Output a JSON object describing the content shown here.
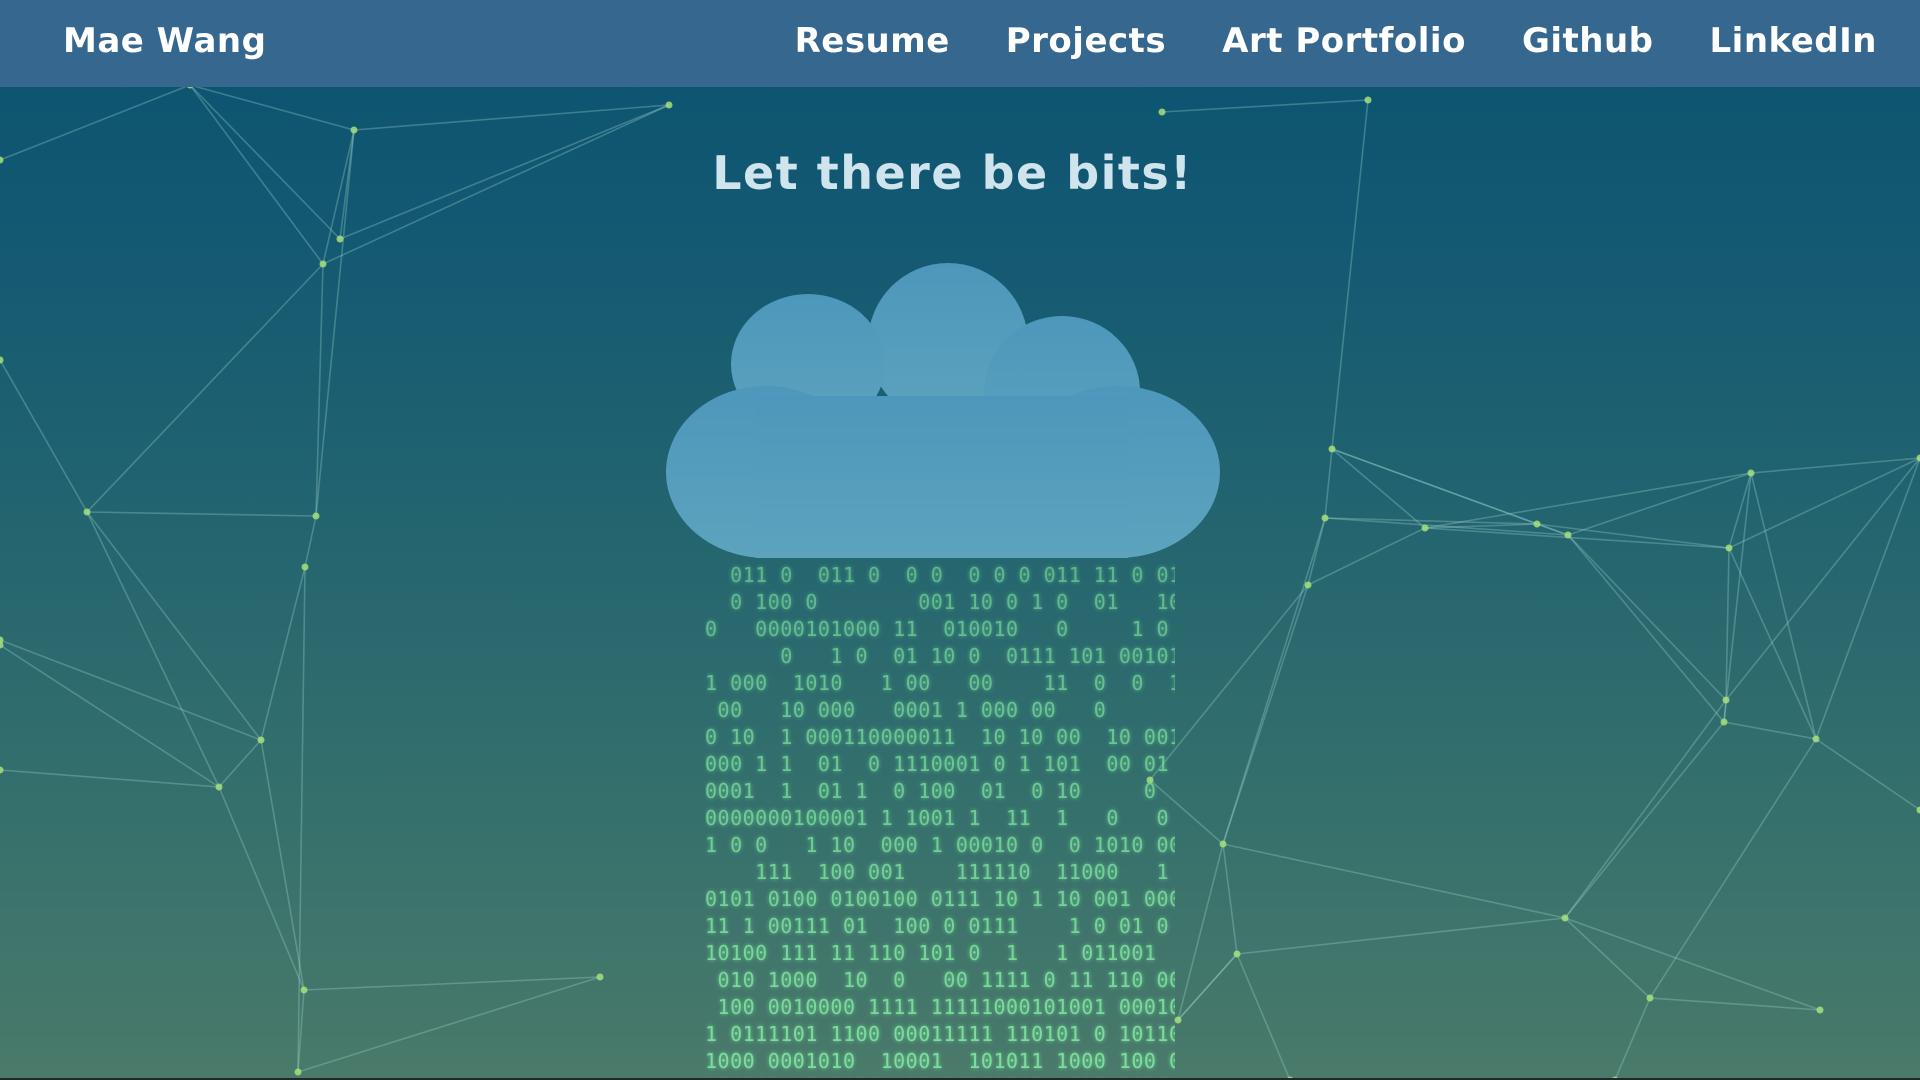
{
  "navbar": {
    "brand": "Mae Wang",
    "links": [
      "Resume",
      "Projects",
      "Art Portfolio",
      "Github",
      "LinkedIn"
    ]
  },
  "hero": {
    "headline": "Let there be bits!",
    "rain_glyphs": [
      "0",
      "1"
    ]
  },
  "colors": {
    "navbar": "#35678f",
    "cloud": "#5aa0bf",
    "network_line": "#9fd8cf",
    "network_node": "#a6e07a",
    "rain": "#7ee2a0"
  }
}
